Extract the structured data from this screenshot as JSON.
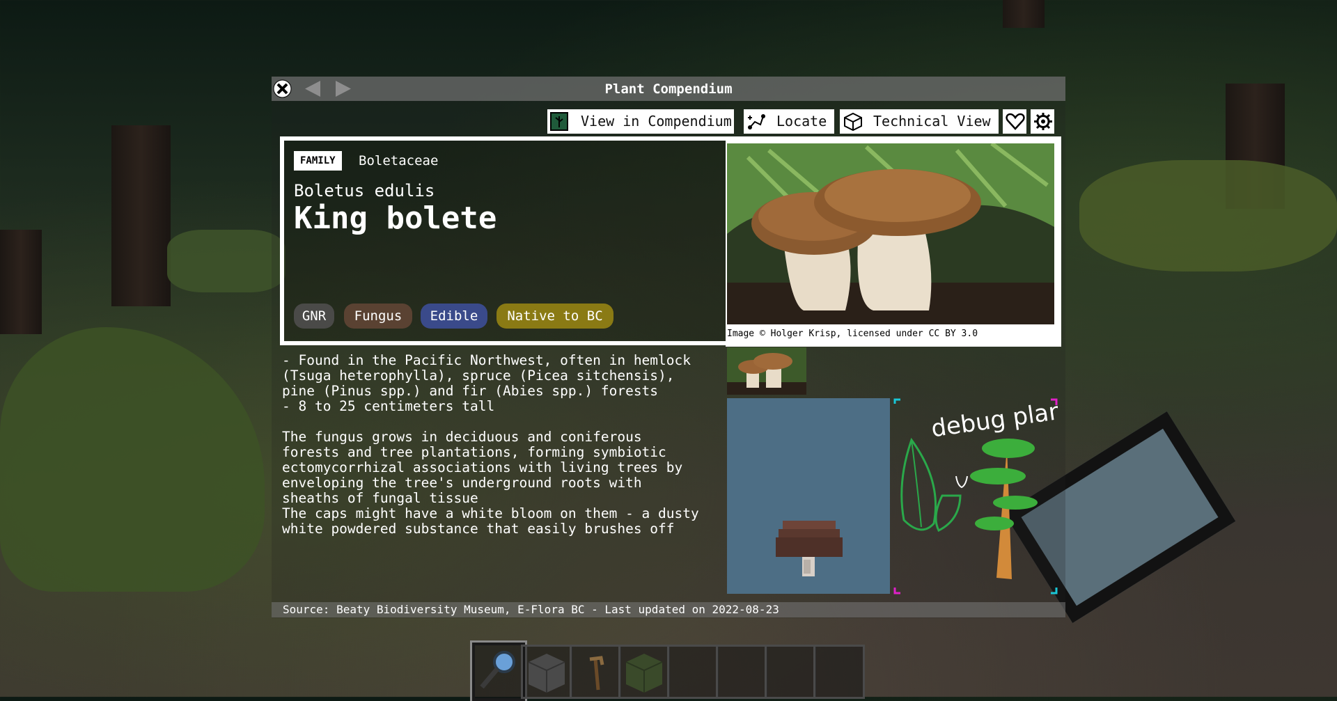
{
  "window": {
    "title": "Plant Compendium"
  },
  "toolbar": {
    "view_in_compendium": "View in Compendium",
    "locate": "Locate",
    "technical_view": "Technical View"
  },
  "plant": {
    "family_label": "FAMILY",
    "family": "Boletaceae",
    "scientific_name": "Boletus edulis",
    "common_name": "King bolete",
    "tags": [
      {
        "label": "GNR",
        "color": "#4a4a48"
      },
      {
        "label": "Fungus",
        "color": "#5a4232"
      },
      {
        "label": "Edible",
        "color": "#3a4a8a"
      },
      {
        "label": "Native to BC",
        "color": "#8a7a14"
      }
    ],
    "image_credit": "Image © Holger Krisp, licensed under CC BY 3.0",
    "description": "- Found in the Pacific Northwest, often in hemlock\n(Tsuga heterophylla), spruce (Picea sitchensis),\npine (Pinus spp.) and fir (Abies spp.) forests\n- 8 to 25 centimeters tall\n\nThe fungus grows in deciduous and coniferous\nforests and tree plantations, forming symbiotic\nectomycorrhizal associations with living trees by\nenveloping the tree's underground roots with\nsheaths of fungal tissue\nThe caps might have a white bloom on them - a dusty\nwhite powdered substance that easily brushes off",
    "debug_text": "debug plant"
  },
  "footer": {
    "text": "Source: Beaty Biodiversity Museum, E-Flora BC  -  Last updated on 2022-08-23"
  },
  "hotbar": {
    "selected_index": 0,
    "items": [
      "magnifier-icon",
      "stone-block-icon",
      "hoe-icon",
      "moss-block-icon",
      "",
      "",
      "",
      ""
    ]
  },
  "colors": {
    "preview_bg": "#4d6e85",
    "debug_corner_cyan": "#19c6d6",
    "debug_corner_magenta": "#e020c8"
  }
}
